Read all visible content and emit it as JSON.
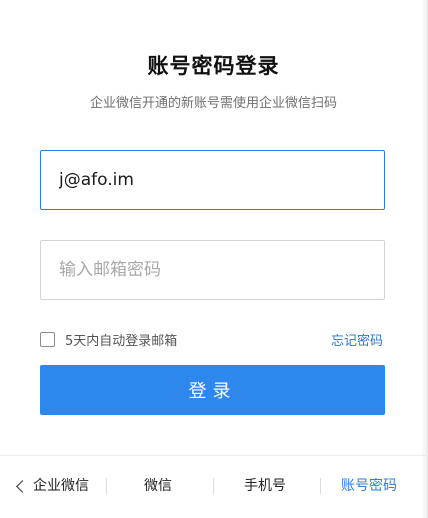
{
  "login": {
    "title": "账号密码登录",
    "subtitle": "企业微信开通的新账号需使用企业微信扫码",
    "email_value": "j@afo.im",
    "password_placeholder": "输入邮箱密码",
    "remember_label": "5天内自动登录邮箱",
    "forgot_label": "忘记密码",
    "submit_label": "登录"
  },
  "tabs": {
    "back_label": "企业微信",
    "wechat_label": "微信",
    "phone_label": "手机号",
    "account_label": "账号密码"
  },
  "colors": {
    "accent": "#2d87ec",
    "link": "#2f75c8"
  },
  "icons": {
    "back": "chevron-left-icon"
  }
}
